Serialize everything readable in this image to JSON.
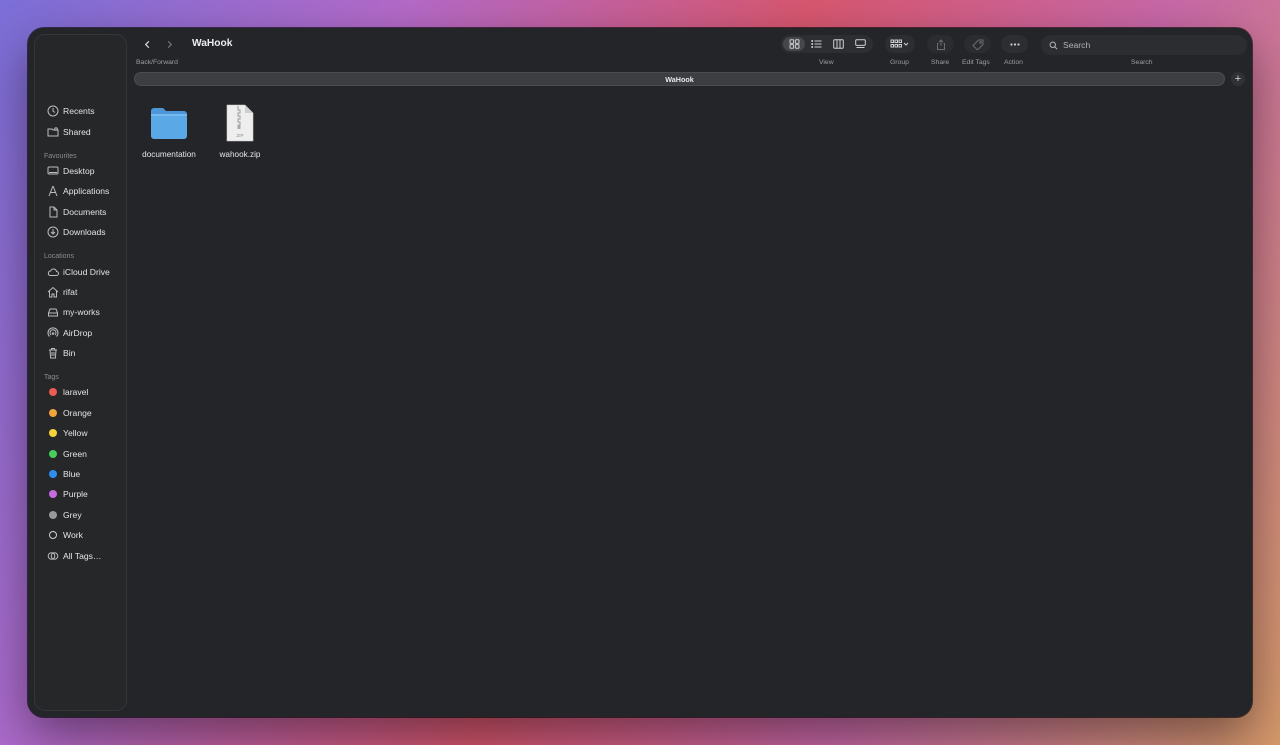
{
  "window": {
    "title": "WaHook",
    "path_label": "WaHook"
  },
  "toolbar": {
    "nav_label": "Back/Forward",
    "view_label": "View",
    "group_label": "Group",
    "share_label": "Share",
    "edit_tags_label": "Edit Tags",
    "action_label": "Action",
    "search_label": "Search",
    "search_placeholder": "Search"
  },
  "sidebar": {
    "top_items": [
      {
        "label": "Recents",
        "icon": "clock-icon"
      },
      {
        "label": "Shared",
        "icon": "shared-folder-icon"
      }
    ],
    "favourites_header": "Favourites",
    "favourites": [
      {
        "label": "Desktop",
        "icon": "desktop-icon"
      },
      {
        "label": "Applications",
        "icon": "applications-icon"
      },
      {
        "label": "Documents",
        "icon": "document-icon"
      },
      {
        "label": "Downloads",
        "icon": "download-icon"
      }
    ],
    "locations_header": "Locations",
    "locations": [
      {
        "label": "iCloud Drive",
        "icon": "cloud-icon"
      },
      {
        "label": "rifat",
        "icon": "home-icon"
      },
      {
        "label": "my-works",
        "icon": "drive-icon"
      },
      {
        "label": "AirDrop",
        "icon": "airdrop-icon"
      },
      {
        "label": "Bin",
        "icon": "trash-icon"
      }
    ],
    "tags_header": "Tags",
    "tags": [
      {
        "label": "laravel",
        "color": "#ec5b54"
      },
      {
        "label": "Orange",
        "color": "#f2a33a"
      },
      {
        "label": "Yellow",
        "color": "#f4d23a"
      },
      {
        "label": "Green",
        "color": "#45cf5a"
      },
      {
        "label": "Blue",
        "color": "#2f8df0"
      },
      {
        "label": "Purple",
        "color": "#c56ae0"
      },
      {
        "label": "Grey",
        "color": "#98989d"
      },
      {
        "label": "Work",
        "color": "none"
      },
      {
        "label": "All Tags…",
        "color": "none"
      }
    ]
  },
  "files": [
    {
      "name": "documentation",
      "icon": "folder-icon",
      "color": "#5aa8e6"
    },
    {
      "name": "wahook.zip",
      "icon": "zip-file-icon",
      "badge": "ZIP"
    }
  ]
}
